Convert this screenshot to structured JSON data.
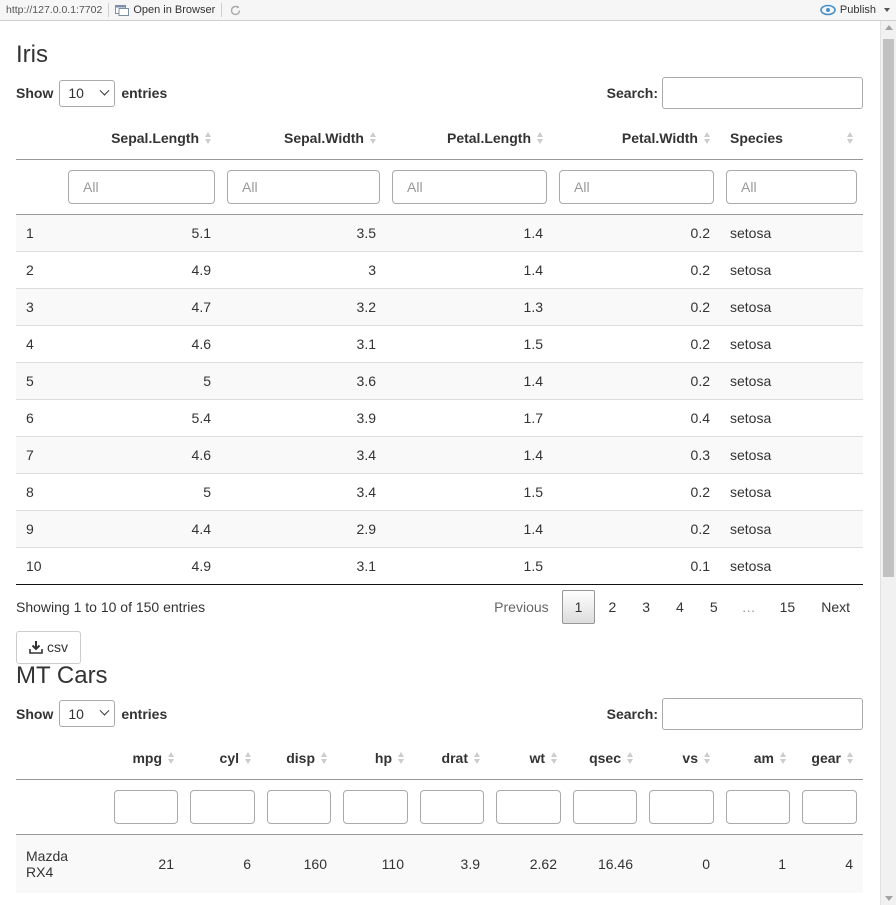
{
  "topbar": {
    "url": "http://127.0.0.1:7702",
    "open_browser": "Open in Browser",
    "publish": "Publish"
  },
  "iris": {
    "title": "Iris",
    "show_label": "Show",
    "entries_value": "10",
    "entries_label": "entries",
    "search_label": "Search:",
    "columns": [
      "",
      "Sepal.Length",
      "Sepal.Width",
      "Petal.Length",
      "Petal.Width",
      "Species"
    ],
    "filter_placeholder": "All",
    "rows": [
      [
        "1",
        "5.1",
        "3.5",
        "1.4",
        "0.2",
        "setosa"
      ],
      [
        "2",
        "4.9",
        "3",
        "1.4",
        "0.2",
        "setosa"
      ],
      [
        "3",
        "4.7",
        "3.2",
        "1.3",
        "0.2",
        "setosa"
      ],
      [
        "4",
        "4.6",
        "3.1",
        "1.5",
        "0.2",
        "setosa"
      ],
      [
        "5",
        "5",
        "3.6",
        "1.4",
        "0.2",
        "setosa"
      ],
      [
        "6",
        "5.4",
        "3.9",
        "1.7",
        "0.4",
        "setosa"
      ],
      [
        "7",
        "4.6",
        "3.4",
        "1.4",
        "0.3",
        "setosa"
      ],
      [
        "8",
        "5",
        "3.4",
        "1.5",
        "0.2",
        "setosa"
      ],
      [
        "9",
        "4.4",
        "2.9",
        "1.4",
        "0.2",
        "setosa"
      ],
      [
        "10",
        "4.9",
        "3.1",
        "1.5",
        "0.1",
        "setosa"
      ]
    ],
    "info": "Showing 1 to 10 of 150 entries",
    "pagination": {
      "previous": "Previous",
      "pages": [
        "1",
        "2",
        "3",
        "4",
        "5"
      ],
      "ellipsis": "…",
      "last": "15",
      "next": "Next",
      "current": "1"
    },
    "csv_button": "csv"
  },
  "mtcars": {
    "title": "MT Cars",
    "show_label": "Show",
    "entries_value": "10",
    "entries_label": "entries",
    "search_label": "Search:",
    "columns": [
      "",
      "mpg",
      "cyl",
      "disp",
      "hp",
      "drat",
      "wt",
      "qsec",
      "vs",
      "am",
      "gear"
    ],
    "rows": [
      [
        "Mazda RX4",
        "21",
        "6",
        "160",
        "110",
        "3.9",
        "2.62",
        "16.46",
        "0",
        "1",
        "4"
      ]
    ]
  }
}
